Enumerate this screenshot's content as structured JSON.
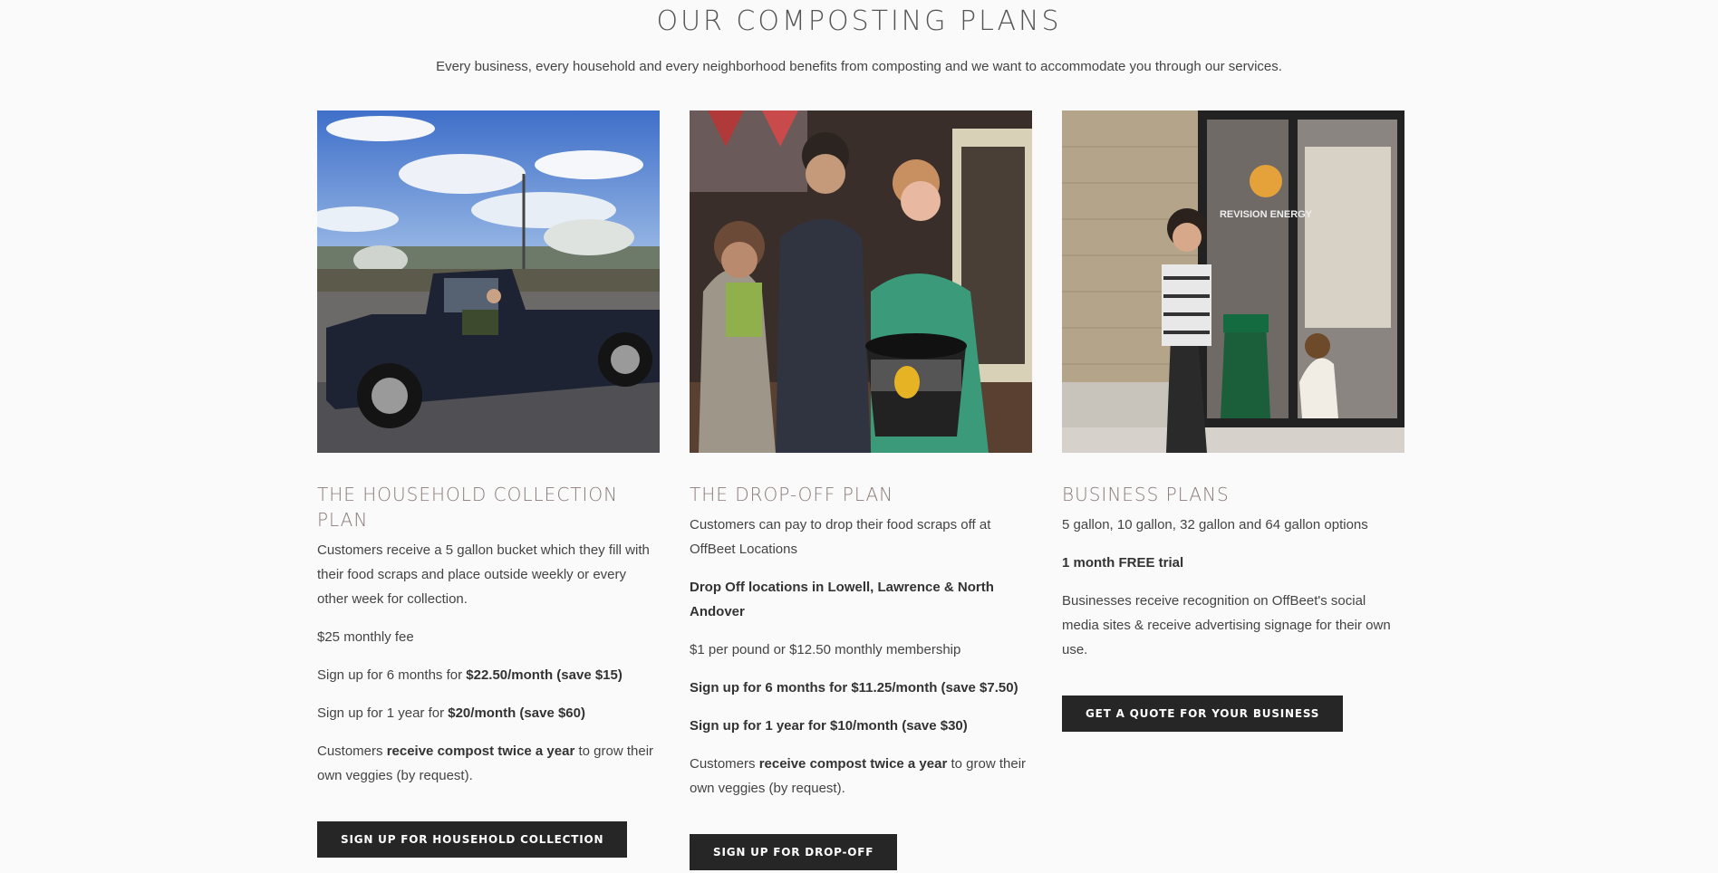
{
  "page": {
    "title": "OUR COMPOSTING PLANS",
    "intro": "Every business, every household and every neighborhood benefits from composting and we want to accommodate you through our services."
  },
  "plans": [
    {
      "title": "THE HOUSEHOLD COLLECTION PLAN",
      "photo_icon": "pickup-truck-photo",
      "paragraphs": [
        "Customers receive a 5 gallon bucket which they fill with their food scraps and place outside weekly or every other week for collection.",
        "$25 monthly fee"
      ],
      "six_month_prefix": "Sign up for 6 months for ",
      "six_month_price": "$22.50/month (save $15)",
      "one_year_prefix": "Sign up for 1 year for ",
      "one_year_price": "$20/month (save $60)",
      "compost_prefix": "Customers ",
      "compost_bold": "receive compost twice a year",
      "compost_suffix": " to grow their own veggies (by request).",
      "button": "SIGN UP FOR HOUSEHOLD COLLECTION"
    },
    {
      "title": "THE DROP-OFF PLAN",
      "photo_icon": "group-with-bucket-photo",
      "intro": "Customers can pay to drop their food scraps off at OffBeet Locations",
      "locations": "Drop Off locations in Lowell, Lawrence & North Andover",
      "pricing": "$1 per pound or $12.50 monthly membership",
      "six_month": "Sign up for 6 months for $11.25/month (save $7.50)",
      "one_year": "Sign up for 1 year for $10/month (save $30)",
      "compost_prefix": "Customers ",
      "compost_bold": "receive compost twice a year",
      "compost_suffix": " to grow their own veggies (by request).",
      "button": "SIGN UP FOR DROP-OFF"
    },
    {
      "title": "BUSINESS PLANS",
      "photo_icon": "business-storefront-photo",
      "options": "5 gallon, 10 gallon, 32 gallon and 64 gallon options",
      "trial": "1 month FREE trial",
      "recognition": "Businesses receive recognition on OffBeet's social media sites & receive advertising signage for their own use.",
      "button": "GET A QUOTE FOR YOUR BUSINESS"
    }
  ],
  "photo_signage": {
    "storefront_text": "REVISION ENERGY"
  },
  "colors": {
    "background": "#fafafa",
    "heading": "#8a7a78",
    "button": "#262626"
  }
}
